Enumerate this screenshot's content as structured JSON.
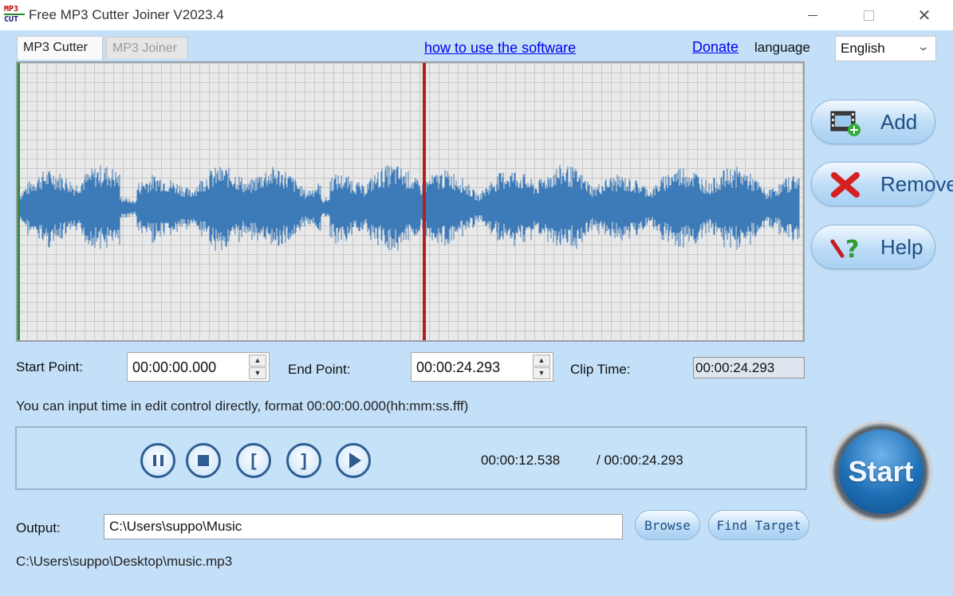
{
  "window": {
    "title": "Free MP3 Cutter Joiner V2023.4",
    "logo_line1": "MP3",
    "logo_line2": "CUT",
    "minimize_label": "",
    "maximize_label": "",
    "close_label": "✕"
  },
  "tabs": [
    {
      "label": "MP3 Cutter",
      "active": true
    },
    {
      "label": "MP3 Joiner",
      "active": false
    }
  ],
  "header": {
    "howto_link": "how to use the software",
    "donate_link": "Donate",
    "language_label": "language",
    "language_value": "English"
  },
  "side_buttons": {
    "add": "Add",
    "remove": "Remove",
    "help": "Help"
  },
  "times": {
    "start_label": "Start Point:",
    "start_value": "00:00:00.000",
    "end_label": "End Point:",
    "end_value": "00:00:24.293",
    "clip_label": "Clip Time:",
    "clip_value": "00:00:24.293"
  },
  "hint": "You can input time in edit control directly, format 00:00:00.000(hh:mm:ss.fff)",
  "player": {
    "current_time": "00:00:12.538",
    "total_time": "/ 00:00:24.293",
    "mark_start_glyph": "[",
    "mark_end_glyph": "]"
  },
  "start_button": "Start",
  "output": {
    "label": "Output:",
    "value": "C:\\Users\\suppo\\Music",
    "browse": "Browse",
    "find_target": "Find Target"
  },
  "source_file": "C:\\Users\\suppo\\Desktop\\music.mp3",
  "colors": {
    "background": "#c3e0f8",
    "waveform": "#3d7ab8",
    "playhead": "#b02020",
    "start_marker": "#2e8b3a"
  },
  "playback_fraction": 0.516
}
